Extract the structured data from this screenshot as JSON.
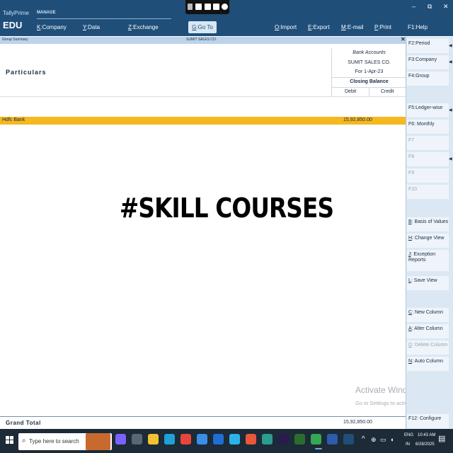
{
  "app": {
    "brand": "TallyPrime",
    "edition": "EDU",
    "manage_label": "MANAGE"
  },
  "menu": [
    {
      "key": "K",
      "label": ":Company"
    },
    {
      "key": "Y",
      "label": ":Data"
    },
    {
      "key": "Z",
      "label": ":Exchange"
    },
    {
      "key": "G",
      "label": ":Go To"
    },
    {
      "key": "O",
      "label": ":Import"
    },
    {
      "key": "E",
      "label": ":Export"
    },
    {
      "key": "M",
      "label": ":E-mail"
    },
    {
      "key": "P",
      "label": ":Print"
    },
    {
      "key": "F1",
      "label": ":Help"
    }
  ],
  "window_controls": {
    "minimize": "–",
    "restore": "⧉",
    "close": "✕"
  },
  "report": {
    "name": "Group Summary",
    "company": "SUMIT SALES CO.",
    "close_glyph": "✕",
    "particulars_header": "Particulars",
    "column": {
      "title": "Bank Accounts",
      "company": "SUMIT SALES CO.",
      "date": "For 1-Apr-23",
      "balance_header": "Closing Balance",
      "debit": "Debit",
      "credit": "Credit"
    },
    "rows": [
      {
        "name": "Hdfc Bank",
        "debit": "15,92,850.00",
        "credit": ""
      }
    ],
    "grand_total": {
      "label": "Grand Total",
      "debit": "15,92,850.00"
    }
  },
  "overlay": {
    "text": "#SKILL COURSES",
    "activate_title": "Activate Windows",
    "activate_sub": "Go to Settings to activate Windows."
  },
  "side_buttons": [
    {
      "key": "F2",
      "label": ":Period",
      "enabled": true,
      "arrow": true
    },
    {
      "key": "F3",
      "label": ":Company",
      "enabled": true,
      "arrow": true
    },
    {
      "key": "F4",
      "label": ":Group",
      "enabled": true,
      "arrow": false
    },
    {
      "key": "F5",
      "label": ":Ledger-wise",
      "enabled": true,
      "arrow": true
    },
    {
      "key": "F6",
      "label": ": Monthly",
      "enabled": true,
      "arrow": false
    },
    {
      "key": "F7",
      "label": "",
      "enabled": false,
      "arrow": false
    },
    {
      "key": "F8",
      "label": "",
      "enabled": false,
      "arrow": true
    },
    {
      "key": "F9",
      "label": "",
      "enabled": false,
      "arrow": false
    },
    {
      "key": "F10",
      "label": "",
      "enabled": false,
      "arrow": false
    },
    {
      "key": "B",
      "label": ": Basis of Values",
      "enabled": true,
      "arrow": false
    },
    {
      "key": "H",
      "label": ": Change View",
      "enabled": true,
      "arrow": false
    },
    {
      "key": "J",
      "label": ": Exception Reports",
      "enabled": true,
      "arrow": false
    },
    {
      "key": "L",
      "label": ": Save View",
      "enabled": true,
      "arrow": false
    },
    {
      "key": "C",
      "label": ": New Column",
      "enabled": true,
      "arrow": false
    },
    {
      "key": "A",
      "label": ": Alter Column",
      "enabled": true,
      "arrow": false
    },
    {
      "key": "D",
      "label": ": Delete Column",
      "enabled": false,
      "arrow": false
    },
    {
      "key": "N",
      "label": ": Auto Column",
      "enabled": true,
      "arrow": false
    },
    {
      "key": "F12",
      "label": ": Configure",
      "enabled": true,
      "arrow": false
    }
  ],
  "taskbar": {
    "search_placeholder": "Type here to search",
    "lang_line1": "ENG",
    "lang_line2": "IN",
    "time": "10:43 AM",
    "date": "6/28/2025",
    "apps": [
      {
        "name": "copilot-icon",
        "color": "#7b61ff"
      },
      {
        "name": "task-view-icon",
        "color": "#5b6673"
      },
      {
        "name": "file-explorer-icon",
        "color": "#f2c230"
      },
      {
        "name": "edge-icon",
        "color": "#1da1d6"
      },
      {
        "name": "chrome-icon",
        "color": "#e8453c"
      },
      {
        "name": "store-icon",
        "color": "#3a8ee6"
      },
      {
        "name": "outlook-icon",
        "color": "#1e6ed6"
      },
      {
        "name": "photos-icon",
        "color": "#2bb3e8"
      },
      {
        "name": "office-icon",
        "color": "#e8573b"
      },
      {
        "name": "media-player-icon",
        "color": "#2a9d8f"
      },
      {
        "name": "premiere-icon",
        "color": "#2a1b4d"
      },
      {
        "name": "xbox-icon",
        "color": "#2b6d2e"
      },
      {
        "name": "chrome-2-icon",
        "color": "#34a853"
      },
      {
        "name": "word-icon",
        "color": "#2b5cad"
      },
      {
        "name": "tally-icon",
        "color": "#1f4e79"
      }
    ]
  },
  "colors": {
    "header_bg": "#1f4e79",
    "highlight_row": "#f5b81f",
    "side_panel": "#dbe8f4",
    "taskbar_bg": "#1d2a37"
  }
}
